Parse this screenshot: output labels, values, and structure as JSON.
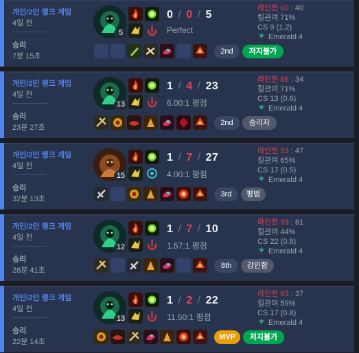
{
  "colors": {
    "accent": "#5383e8",
    "kills": "#f2f2f2",
    "deaths": "#e84057",
    "badge_green": "#00a651",
    "badge_mvp": "#e89f0b"
  },
  "matches": [
    {
      "queue": "개인/2인 랭크 게임",
      "ago": "4일 전",
      "result": "승리",
      "duration": "7분 15초",
      "champion_icon": "champion-portrait-icon",
      "level": "5",
      "kills": "0",
      "deaths": "0",
      "assists": "5",
      "ratio": "Perfect",
      "badge_place": "2nd",
      "badge_tag": "저지불가",
      "lane_label": "라인전 60",
      "lane_opp": "40",
      "kill_participation": "킬관여 71%",
      "cs": "CS 9 (1.2)",
      "rank": "Emerald 4"
    },
    {
      "queue": "개인/2인 랭크 게임",
      "ago": "4일 전",
      "result": "승리",
      "duration": "23분 27초",
      "champion_icon": "champion-portrait-icon",
      "level": "13",
      "kills": "1",
      "deaths": "4",
      "assists": "23",
      "ratio": "6.00:1 평점",
      "badge_place": "2nd",
      "badge_tag": "승리자",
      "lane_label": "라인전 66",
      "lane_opp": "34",
      "kill_participation": "킬관여 71%",
      "cs": "CS 13 (0.6)",
      "rank": "Emerald 4"
    },
    {
      "queue": "개인/2인 랭크 게임",
      "ago": "4일 전",
      "result": "승리",
      "duration": "32분 13초",
      "champion_icon": "champion-portrait-icon",
      "level": "15",
      "kills": "1",
      "deaths": "7",
      "assists": "27",
      "ratio": "4.00:1 평점",
      "badge_place": "3rd",
      "badge_tag": "평범",
      "lane_label": "라인전 53",
      "lane_opp": "47",
      "kill_participation": "킬관여 65%",
      "cs": "CS 17 (0.5)",
      "rank": "Emerald 4"
    },
    {
      "queue": "개인/2인 랭크 게임",
      "ago": "4일 전",
      "result": "승리",
      "duration": "28분 41초",
      "champion_icon": "champion-portrait-icon",
      "level": "12",
      "kills": "1",
      "deaths": "7",
      "assists": "10",
      "ratio": "1.57:1 평점",
      "badge_place": "8th",
      "badge_tag": "강인함",
      "lane_label": "라인전 39",
      "lane_opp": "61",
      "kill_participation": "킬관여 44%",
      "cs": "CS 22 (0.8)",
      "rank": "Emerald 4"
    },
    {
      "queue": "개인/2인 랭크 게임",
      "ago": "4일 전",
      "result": "승리",
      "duration": "22분 14초",
      "champion_icon": "champion-portrait-icon",
      "level": "13",
      "kills": "1",
      "deaths": "2",
      "assists": "22",
      "ratio": "11.50:1 평점",
      "badge_place": "MVP",
      "badge_tag": "저지불가",
      "lane_label": "라인전 63",
      "lane_opp": "37",
      "kill_participation": "킬관여 59%",
      "cs": "CS 17 (0.8)",
      "rank": "Emerald 4"
    }
  ]
}
